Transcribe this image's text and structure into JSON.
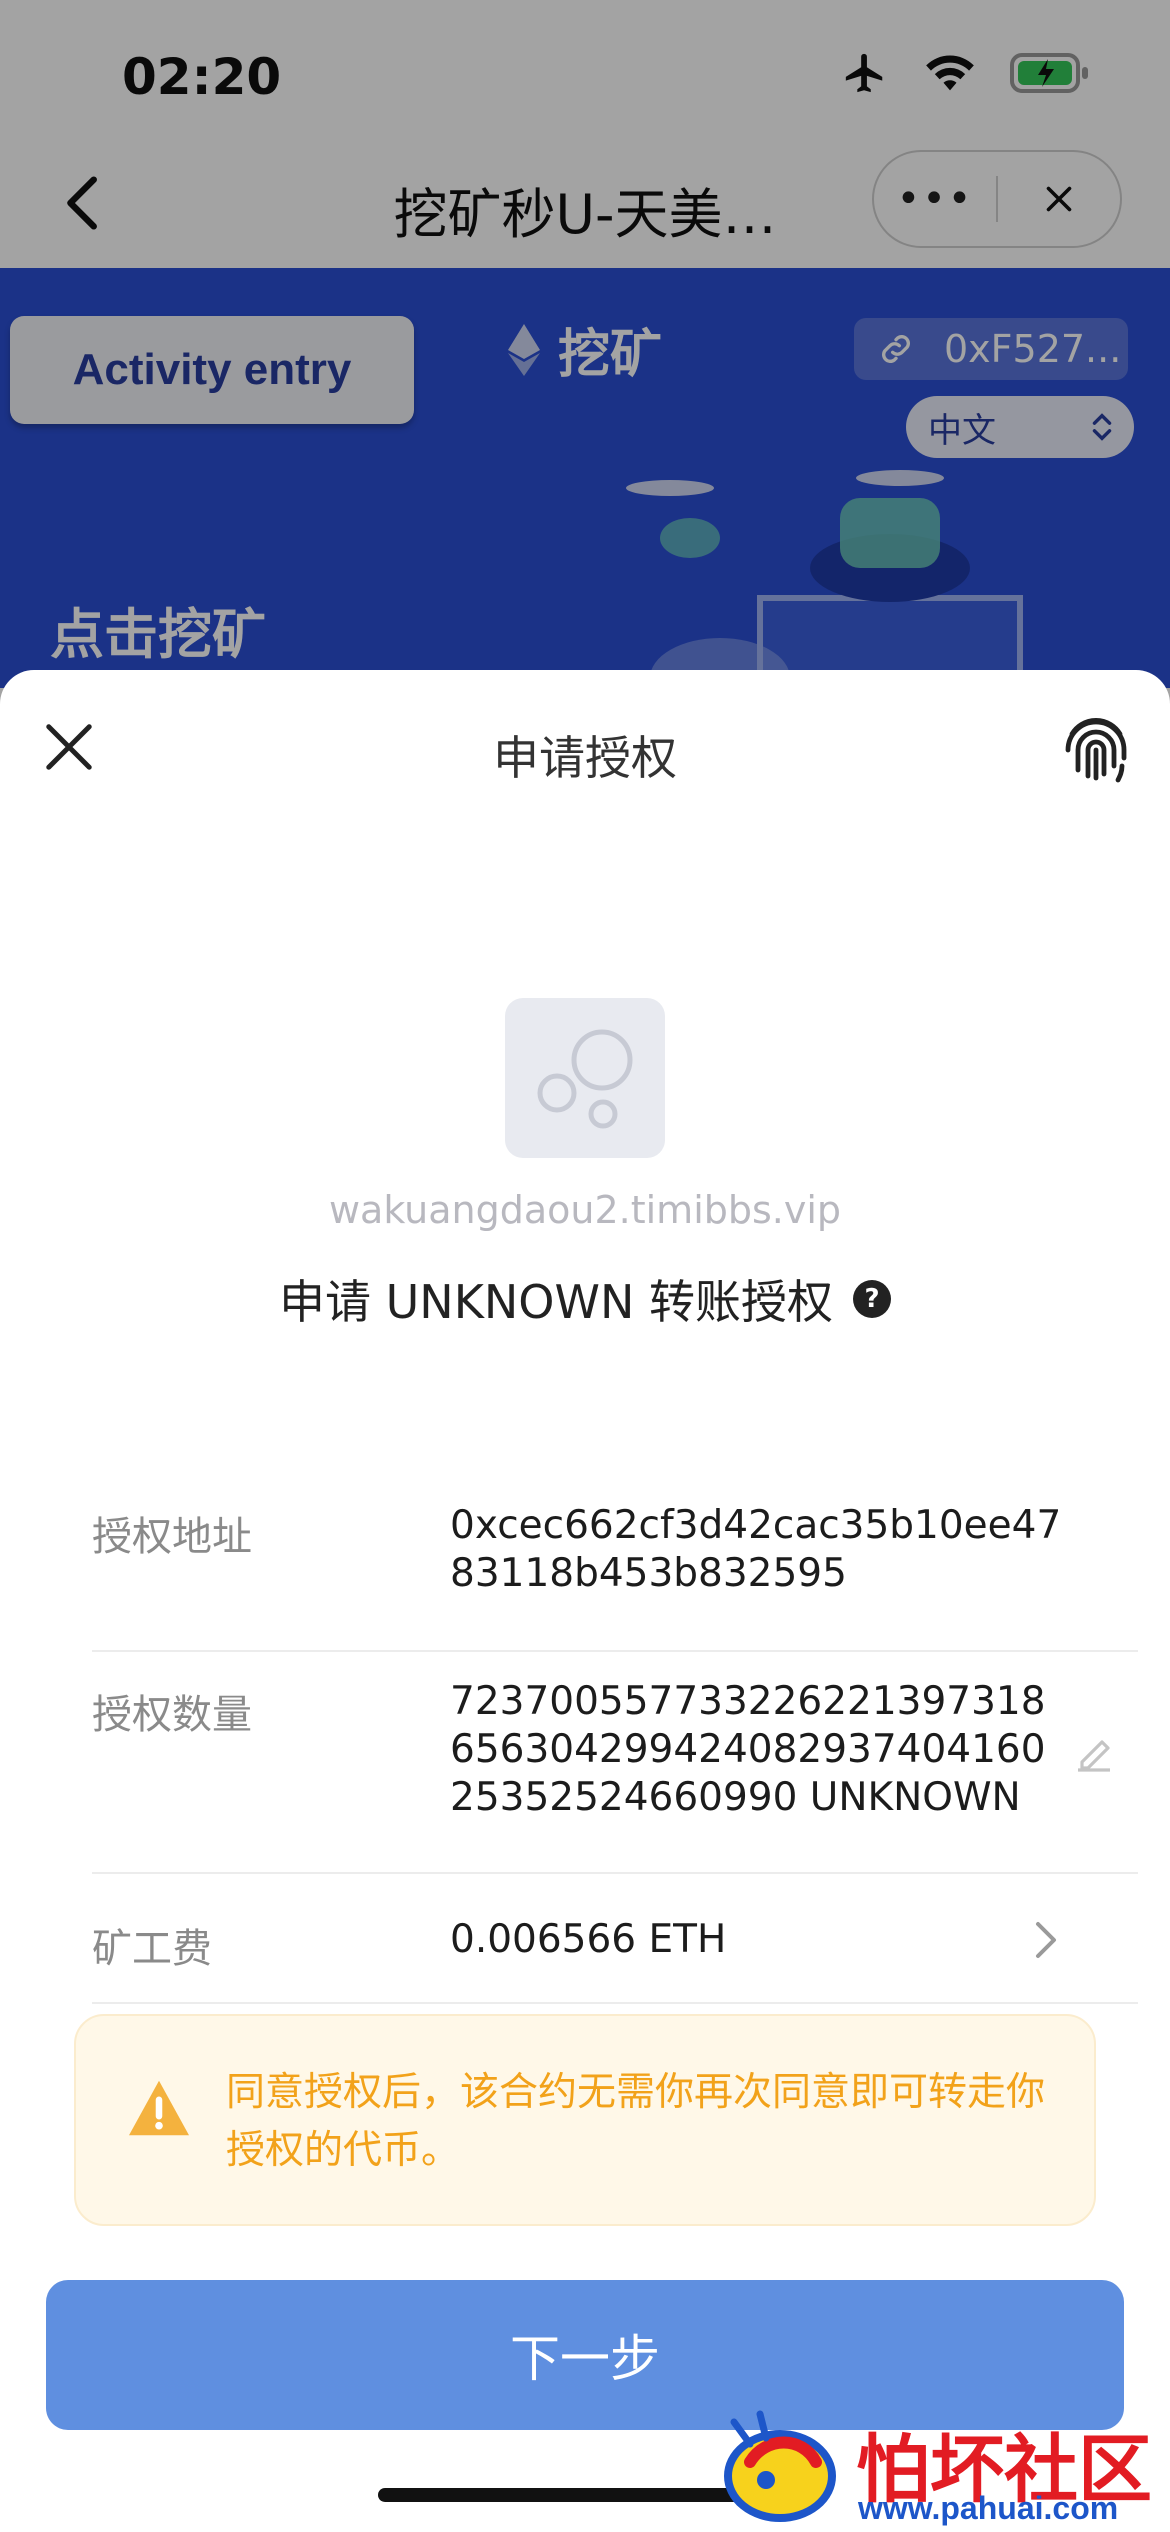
{
  "status_bar": {
    "time": "02:20"
  },
  "nav": {
    "title": "挖矿秒U-天美…",
    "more_label": "•••"
  },
  "hero": {
    "activity_button": "Activity entry",
    "mine_label": "挖矿",
    "wallet_address": "0xF527...",
    "language": "中文",
    "tagline": "点击挖矿"
  },
  "sheet": {
    "title": "申请授权",
    "dapp_domain": "wakuangdaou2.timibbs.vip",
    "request_text": "申请 UNKNOWN 转账授权",
    "help_glyph": "?",
    "rows": [
      {
        "label": "授权地址",
        "value": "0xcec662cf3d42cac35b10ee4783118b453b832595"
      },
      {
        "label": "授权数量",
        "value": "72370055773322622139731865630429942408293740416025352524660990 UNKNOWN"
      },
      {
        "label": "矿工费",
        "value": "0.006566 ETH"
      }
    ],
    "warning": "同意授权后，该合约无需你再次同意即可转走你授权的代币。",
    "next_button": "下一步"
  },
  "watermark": {
    "text": "怕坏社区",
    "url": "www.pahuai.com"
  },
  "colors": {
    "hero_blue": "#2b4fd3",
    "primary_button": "#5f8fe0",
    "warning_text": "#f2a21a",
    "warning_bg": "#fff8e8"
  },
  "icons": [
    "airplane-icon",
    "wifi-icon",
    "battery-icon",
    "back-icon",
    "more-icon",
    "close-icon",
    "ethereum-icon",
    "link-icon",
    "updown-icon",
    "fingerprint-icon",
    "dapp-logo-icon",
    "help-icon",
    "edit-icon",
    "chevron-right-icon",
    "warning-icon"
  ]
}
